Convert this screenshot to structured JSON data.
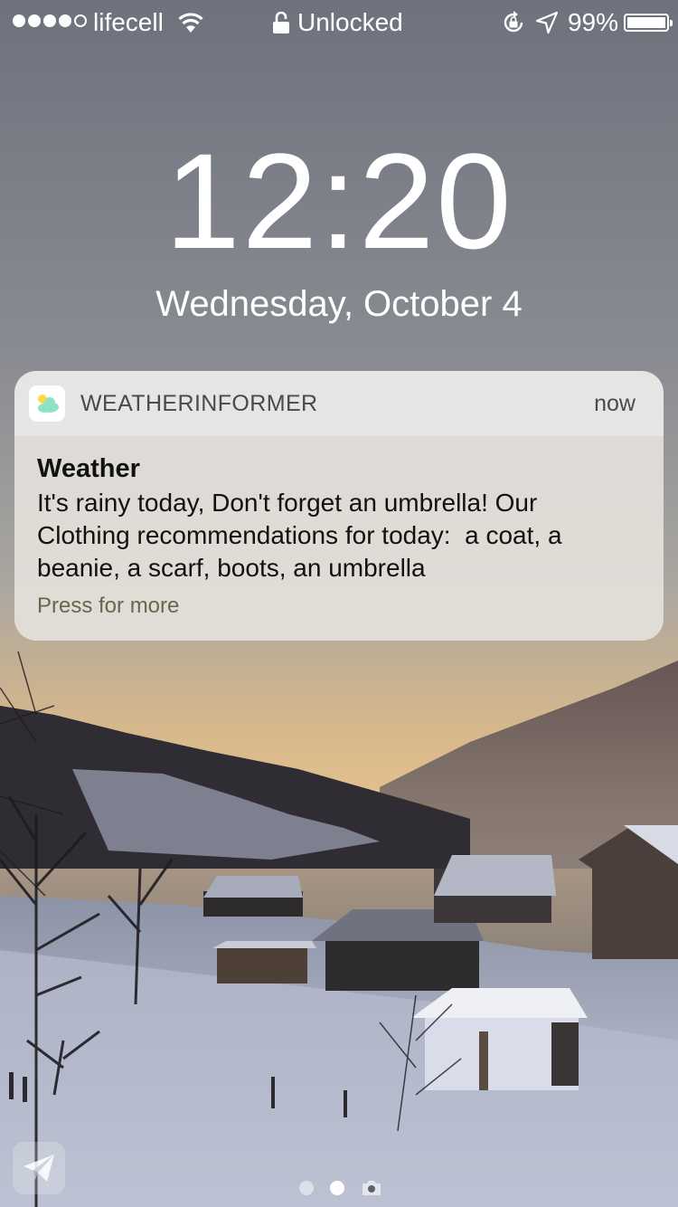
{
  "status_bar": {
    "signal_filled": 4,
    "signal_total": 5,
    "carrier": "lifecell",
    "wifi_icon": "wifi-icon",
    "lock_status": "Unlocked",
    "orientation_icon": "orientation-lock-icon",
    "location_icon": "location-arrow-icon",
    "battery_percent": "99%",
    "battery_level": 0.99
  },
  "lock_screen": {
    "time": "12:20",
    "date": "Wednesday, October 4"
  },
  "notification": {
    "app_icon": "weather-cloud-sun-icon",
    "app_name": "WEATHERINFORMER",
    "time": "now",
    "title": "Weather",
    "message": "It's rainy today, Don't forget an umbrella! Our\nClothing recommendations for today:  a coat, a\nbeanie, a scarf, boots, an umbrella",
    "action_hint": "Press for more"
  },
  "bottom": {
    "shortcut_icon": "paper-plane-icon",
    "page_indicators": [
      "page-dot",
      "page-dot-active",
      "camera-icon"
    ]
  },
  "colors": {
    "notification_header_bg": "#EEEDEA",
    "notification_body_bg": "#E4E1DB",
    "press_more_text": "#6D6450"
  }
}
